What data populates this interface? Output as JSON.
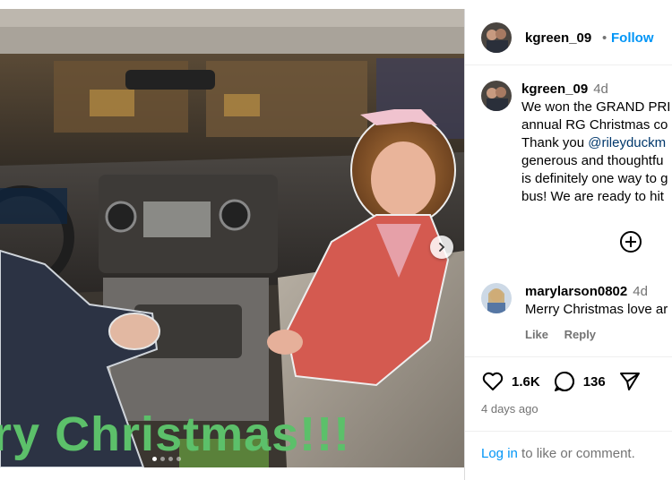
{
  "post": {
    "image_caption_text": "rry Christmas!!!",
    "carousel": {
      "dot_count": 4,
      "active_index": 0
    }
  },
  "header": {
    "username": "kgreen_09",
    "separator": "•",
    "follow_label": "Follow"
  },
  "caption": {
    "username": "kgreen_09",
    "age": "4d",
    "lines": [
      "We won the GRAND PRI",
      "annual RG Christmas co",
      "Thank you ",
      "generous and thoughtfu",
      "is definitely one way to g",
      "bus! We are ready to hit"
    ],
    "mention": "@rileyduckm"
  },
  "comment": {
    "username": "marylarson0802",
    "age": "4d",
    "text": "Merry Christmas love ar",
    "like_label": "Like",
    "reply_label": "Reply"
  },
  "stats": {
    "likes": "1.6K",
    "comments": "136",
    "posted_ago": "4 days ago"
  },
  "footer": {
    "login_label": "Log in",
    "rest": " to like or comment."
  },
  "icons": {
    "heart": "heart-icon",
    "comment": "comment-icon",
    "share": "share-icon",
    "add": "plus-circle-icon",
    "next": "chevron-right-icon"
  },
  "colors": {
    "link_blue": "#0095f6",
    "mention_blue": "#00376b",
    "muted": "#737373",
    "overlay_green": "#5cc06a"
  }
}
